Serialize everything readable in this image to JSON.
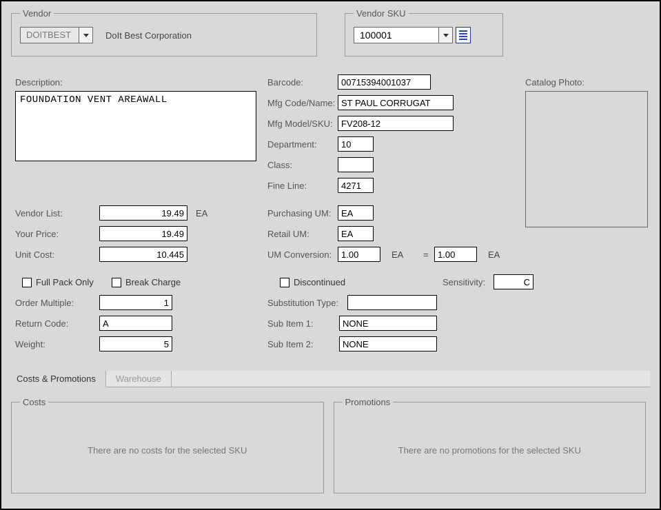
{
  "vendor": {
    "legend": "Vendor",
    "code": "DOITBEST",
    "name": "DoIt Best Corporation"
  },
  "vendor_sku": {
    "legend": "Vendor SKU",
    "value": "100001"
  },
  "labels": {
    "description": "Description:",
    "barcode": "Barcode:",
    "mfg_code": "Mfg Code/Name:",
    "mfg_model": "Mfg Model/SKU:",
    "department": "Department:",
    "class": "Class:",
    "fine_line": "Fine Line:",
    "vendor_list": "Vendor List:",
    "your_price": "Your Price:",
    "unit_cost": "Unit Cost:",
    "purchasing_um": "Purchasing UM:",
    "retail_um": "Retail UM:",
    "um_conversion": "UM Conversion:",
    "full_pack": "Full Pack Only",
    "break_charge": "Break Charge",
    "discontinued": "Discontinued",
    "sensitivity": "Sensitivity:",
    "order_multiple": "Order Multiple:",
    "substitution_type": "Substitution Type:",
    "return_code": "Return Code:",
    "sub_item1": "Sub Item 1:",
    "weight": "Weight:",
    "sub_item2": "Sub Item 2:",
    "catalog_photo": "Catalog Photo:",
    "equals": "="
  },
  "values": {
    "description": "FOUNDATION VENT AREAWALL",
    "barcode": "00715394001037",
    "mfg_code": "ST PAUL CORRUGAT",
    "mfg_model": "FV208-12",
    "department": "10",
    "class": "",
    "fine_line": "4271",
    "vendor_list": "19.49",
    "vendor_list_unit": "EA",
    "your_price": "19.49",
    "unit_cost": "10.445",
    "purchasing_um": "EA",
    "retail_um": "EA",
    "um_conv_a": "1.00",
    "um_conv_a_unit": "EA",
    "um_conv_b": "1.00",
    "um_conv_b_unit": "EA",
    "sensitivity": "C",
    "order_multiple": "1",
    "substitution_type": "",
    "return_code": "A",
    "sub_item1": "NONE",
    "weight": "5",
    "sub_item2": "NONE"
  },
  "tabs": {
    "costs_promotions": "Costs & Promotions",
    "warehouse": "Warehouse",
    "costs_legend": "Costs",
    "promotions_legend": "Promotions",
    "no_costs": "There are no costs for the selected SKU",
    "no_promotions": "There are no promotions for the selected SKU"
  }
}
